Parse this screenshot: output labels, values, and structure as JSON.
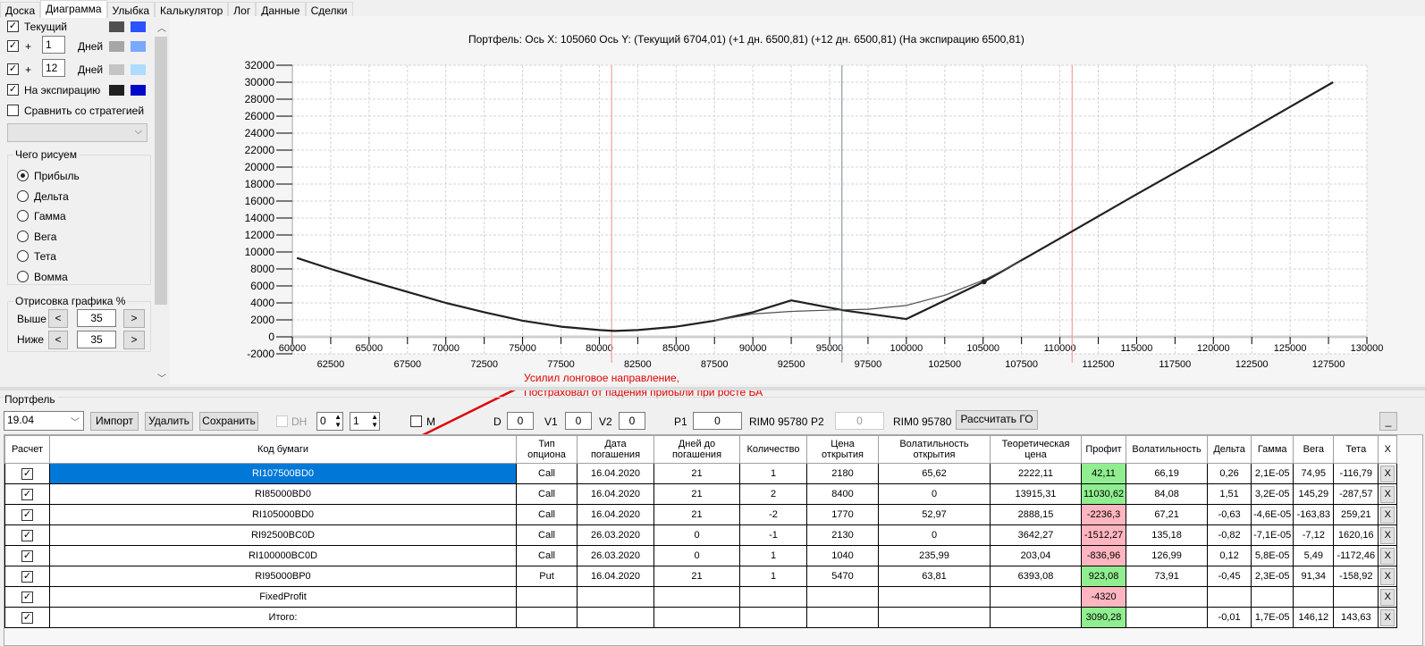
{
  "tabs": [
    "Доска",
    "Диаграмма",
    "Улыбка",
    "Калькулятор",
    "Лог",
    "Данные",
    "Сделки"
  ],
  "active_tab": "Диаграмма",
  "left_panel": {
    "current_label": "Текущий",
    "plus": "+",
    "day1_value": "1",
    "day2_value": "12",
    "days_label": "Дней",
    "expiration_label": "На экспирацию",
    "compare_label": "Сравнить со стратегией",
    "colors": {
      "current": [
        "#505050",
        "#2a52ff"
      ],
      "day1": [
        "#a6a6a6",
        "#79a8ff"
      ],
      "day2": [
        "#c4c4c4",
        "#aedbff"
      ],
      "expiration": [
        "#202020",
        "#0008c8"
      ]
    },
    "draw_group_title": "Чего рисуем",
    "draw_options": [
      "Прибыль",
      "Дельта",
      "Гамма",
      "Вега",
      "Тета",
      "Вомма"
    ],
    "draw_selected": "Прибыль",
    "range_group_title": "Отрисовка графика %",
    "above_label": "Выше",
    "below_label": "Ниже",
    "above_value": "35",
    "below_value": "35",
    "dec": "<",
    "inc": ">"
  },
  "chart_data": {
    "type": "line",
    "title": "Портфель: Ось X: 105060 Ось Y:  (Текущий 6704,01)  (+1 дн. 6500,81)  (+12 дн. 6500,81)  (На экспирацию 6500,81)",
    "xlim": [
      60000,
      130000
    ],
    "ylim": [
      -2000,
      32000
    ],
    "xticks_major": [
      60000,
      65000,
      70000,
      75000,
      80000,
      85000,
      90000,
      95000,
      100000,
      105000,
      110000,
      115000,
      120000,
      125000,
      130000
    ],
    "xticks_minor": [
      62500,
      67500,
      72500,
      77500,
      82500,
      87500,
      92500,
      97500,
      102500,
      107500,
      112500,
      117500,
      122500,
      127500
    ],
    "yticks": [
      -2000,
      0,
      2000,
      4000,
      6000,
      8000,
      10000,
      12000,
      14000,
      16000,
      18000,
      20000,
      22000,
      24000,
      26000,
      28000,
      30000,
      32000
    ],
    "grid": true,
    "series": [
      {
        "key": "expiration",
        "color": "#202020",
        "x": [
          60300,
          62500,
          65000,
          67500,
          70000,
          72500,
          75000,
          77500,
          80000,
          81000,
          82500,
          85000,
          87500,
          90000,
          92500,
          96000,
          100000,
          105060,
          110000,
          115000,
          120000,
          125000,
          127800
        ],
        "y": [
          9300,
          8000,
          6600,
          5300,
          4000,
          2900,
          1900,
          1200,
          800,
          700,
          800,
          1200,
          1900,
          2900,
          4300,
          3100,
          2100,
          6500,
          11600,
          16800,
          21900,
          27100,
          30000
        ]
      },
      {
        "key": "current",
        "color": "#505050",
        "x": [
          87500,
          90000,
          92500,
          95000,
          97500,
          100000,
          102500,
          105060,
          107500
        ],
        "y": [
          1900,
          2700,
          3000,
          3150,
          3250,
          3700,
          4900,
          6700,
          8950
        ]
      }
    ],
    "marker": {
      "x": 105060,
      "y": 6500
    },
    "vlines": [
      {
        "x": 80800,
        "color": "#f4a0a0"
      },
      {
        "x": 95800,
        "color": "#8a9aa8"
      },
      {
        "x": 110800,
        "color": "#f4a0a0"
      }
    ]
  },
  "annotation": {
    "line1": "Усилил лонговое направление,",
    "line2": "Постраховал от падения прибыли при росте БА",
    "color": "#e00000"
  },
  "portfolio": {
    "group_title": "Портфель",
    "selector_value": "19.04",
    "import_label": "Импорт",
    "delete_label": "Удалить",
    "save_label": "Сохранить",
    "dh_label": "DH",
    "spin1": "0",
    "spin2": "1",
    "m_label": "M",
    "d_label": "D",
    "d_value": "0",
    "v1_label": "V1",
    "v1_value": "0",
    "v2_label": "V2",
    "v2_value": "0",
    "p1_label": "P1",
    "p1_value": "0",
    "rim1": "RIM0 95780",
    "p2_label": "P2",
    "p2_value": "0",
    "rim2": "RIM0 95780",
    "calc_go_label": "Рассчитать ГО",
    "minimize_label": "_"
  },
  "table": {
    "headers": [
      "Расчет",
      "Код бумаги",
      "Тип опциона",
      "Дата погашения",
      "Дней до погашения",
      "Количество",
      "Цена открытия",
      "Волатильность открытия",
      "Теоретическая цена",
      "Профит",
      "Волатильность",
      "Дельта",
      "Гамма",
      "Вега",
      "Тета",
      "X"
    ],
    "rows": [
      {
        "code": "RI107500BD0",
        "type": "Call",
        "date": "16.04.2020",
        "days": "21",
        "qty": "1",
        "open": "2180",
        "vol_open": "65,62",
        "theo": "2222,11",
        "profit": "42,11",
        "profit_sign": "pos",
        "vol": "66,19",
        "delta": "0,26",
        "gamma": "2,1E-05",
        "vega": "74,95",
        "theta": "-116,79",
        "selected": true
      },
      {
        "code": "RI85000BD0",
        "type": "Call",
        "date": "16.04.2020",
        "days": "21",
        "qty": "2",
        "open": "8400",
        "vol_open": "0",
        "theo": "13915,31",
        "profit": "11030,62",
        "profit_sign": "pos",
        "vol": "84,08",
        "delta": "1,51",
        "gamma": "3,2E-05",
        "vega": "145,29",
        "theta": "-287,57"
      },
      {
        "code": "RI105000BD0",
        "type": "Call",
        "date": "16.04.2020",
        "days": "21",
        "qty": "-2",
        "open": "1770",
        "vol_open": "52,97",
        "theo": "2888,15",
        "profit": "-2236,3",
        "profit_sign": "neg",
        "vol": "67,21",
        "delta": "-0,63",
        "gamma": "-4,6E-05",
        "vega": "-163,83",
        "theta": "259,21"
      },
      {
        "code": "RI92500BC0D",
        "type": "Call",
        "date": "26.03.2020",
        "days": "0",
        "qty": "-1",
        "open": "2130",
        "vol_open": "0",
        "theo": "3642,27",
        "profit": "-1512,27",
        "profit_sign": "neg",
        "vol": "135,18",
        "delta": "-0,82",
        "gamma": "-7,1E-05",
        "vega": "-7,12",
        "theta": "1620,16"
      },
      {
        "code": "RI100000BC0D",
        "type": "Call",
        "date": "26.03.2020",
        "days": "0",
        "qty": "1",
        "open": "1040",
        "vol_open": "235,99",
        "theo": "203,04",
        "profit": "-836,96",
        "profit_sign": "neg",
        "vol": "126,99",
        "delta": "0,12",
        "gamma": "5,8E-05",
        "vega": "5,49",
        "theta": "-1172,46"
      },
      {
        "code": "RI95000BP0",
        "type": "Put",
        "date": "16.04.2020",
        "days": "21",
        "qty": "1",
        "open": "5470",
        "vol_open": "63,81",
        "theo": "6393,08",
        "profit": "923,08",
        "profit_sign": "pos",
        "vol": "73,91",
        "delta": "-0,45",
        "gamma": "2,3E-05",
        "vega": "91,34",
        "theta": "-158,92"
      },
      {
        "code": "FixedProfit",
        "type": "",
        "date": "",
        "days": "",
        "qty": "",
        "open": "",
        "vol_open": "",
        "theo": "",
        "profit": "-4320",
        "profit_sign": "neg",
        "vol": "",
        "delta": "",
        "gamma": "",
        "vega": "",
        "theta": ""
      },
      {
        "code": "Итого:",
        "type": "",
        "date": "",
        "days": "",
        "qty": "",
        "open": "",
        "vol_open": "",
        "theo": "",
        "profit": "3090,28",
        "profit_sign": "pos",
        "vol": "",
        "delta": "-0,01",
        "gamma": "1,7E-05",
        "vega": "146,12",
        "theta": "143,63"
      }
    ],
    "row_delete_label": "X",
    "check_glyph": "✓"
  },
  "icons": {
    "scroll_up": "chevron-up-icon",
    "scroll_down": "chevron-down-icon",
    "dropdown": "chevron-down-icon"
  }
}
